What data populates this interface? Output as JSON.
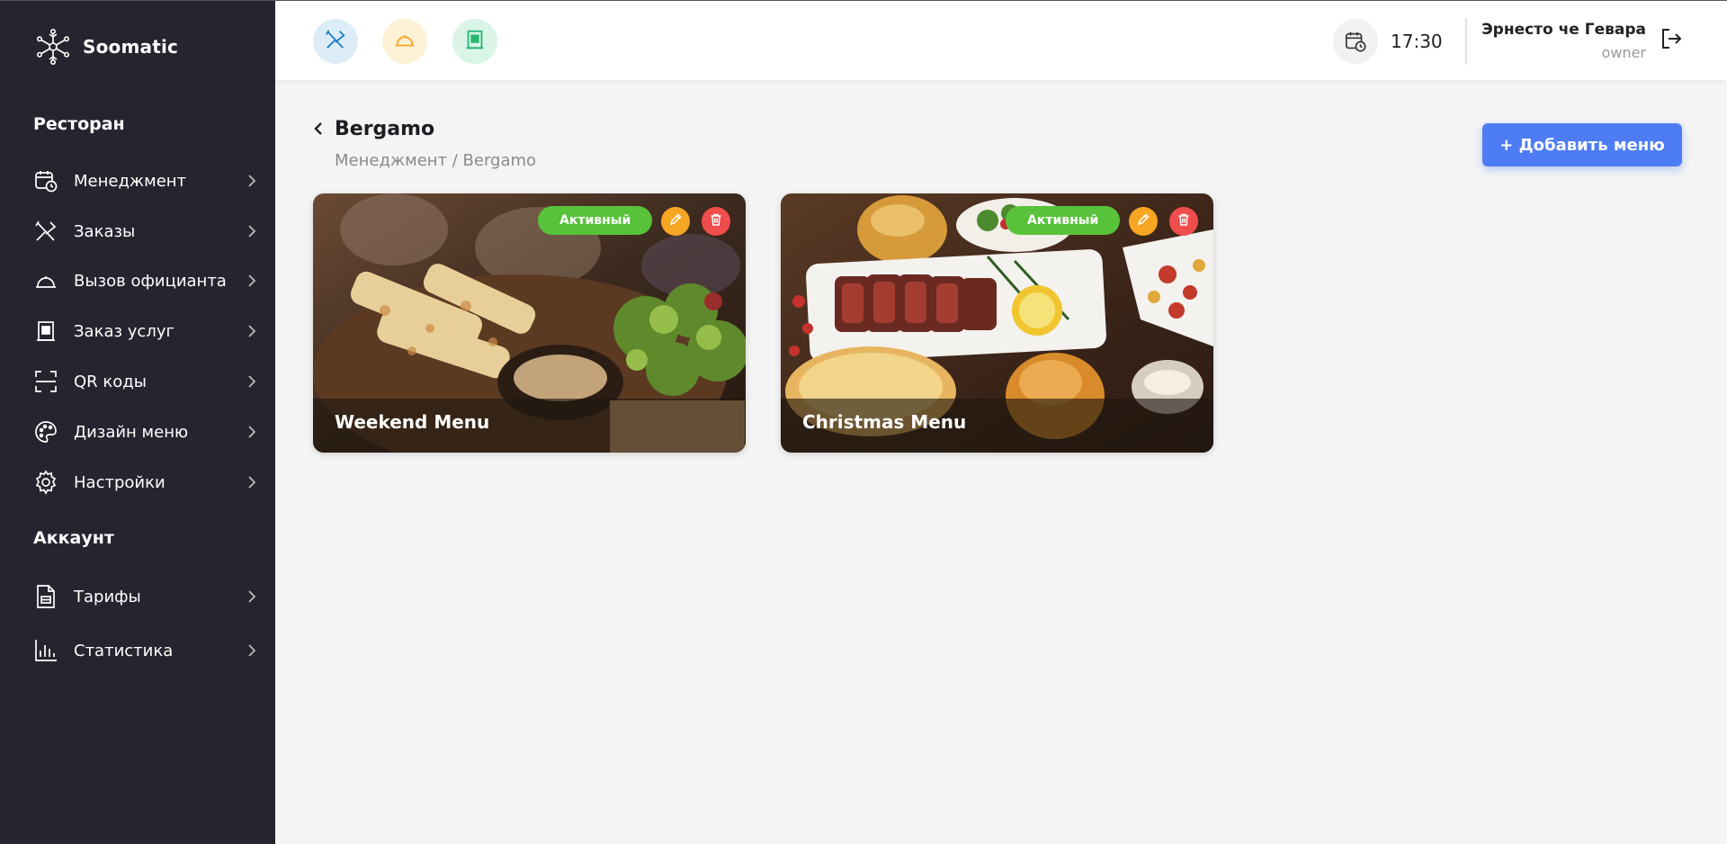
{
  "brand": {
    "name": "Soomatic"
  },
  "sidebar": {
    "section_restaurant": "Ресторан",
    "section_account": "Аккаунт",
    "items": [
      {
        "label": "Менеджмент",
        "icon": "calendar-clock-icon"
      },
      {
        "label": "Заказы",
        "icon": "fork-knife-icon"
      },
      {
        "label": "Вызов официанта",
        "icon": "cloche-icon"
      },
      {
        "label": "Заказ услуг",
        "icon": "service-icon"
      },
      {
        "label": "QR коды",
        "icon": "qr-scan-icon"
      },
      {
        "label": "Дизайн меню",
        "icon": "palette-icon"
      },
      {
        "label": "Настройки",
        "icon": "gear-icon"
      }
    ],
    "account_items": [
      {
        "label": "Тарифы",
        "icon": "document-icon"
      },
      {
        "label": "Статистика",
        "icon": "bar-chart-icon"
      }
    ]
  },
  "header": {
    "quick_actions": [
      {
        "icon": "fork-knife-icon",
        "color": "#1f7fc0",
        "bg": "#dcedf8"
      },
      {
        "icon": "cloche-icon",
        "color": "#f6a623",
        "bg": "#fdf1d6"
      },
      {
        "icon": "service-icon",
        "color": "#2bb673",
        "bg": "#daf5e8"
      }
    ],
    "time": "17:30",
    "user_name": "Эрнесто че Гевара",
    "user_role": "owner"
  },
  "page": {
    "title": "Bergamo",
    "breadcrumb_parent": "Менеджмент",
    "breadcrumb_sep": " / ",
    "breadcrumb_current": "Bergamo",
    "add_button": "+ Добавить меню"
  },
  "menus": [
    {
      "name": "Weekend Menu",
      "status": "Активный"
    },
    {
      "name": "Christmas Menu",
      "status": "Активный"
    }
  ],
  "colors": {
    "sidebar_bg": "#25252f",
    "accent": "#4d7cf5",
    "active_badge": "#58c33a",
    "edit": "#f6a623",
    "delete": "#f04d4d"
  }
}
